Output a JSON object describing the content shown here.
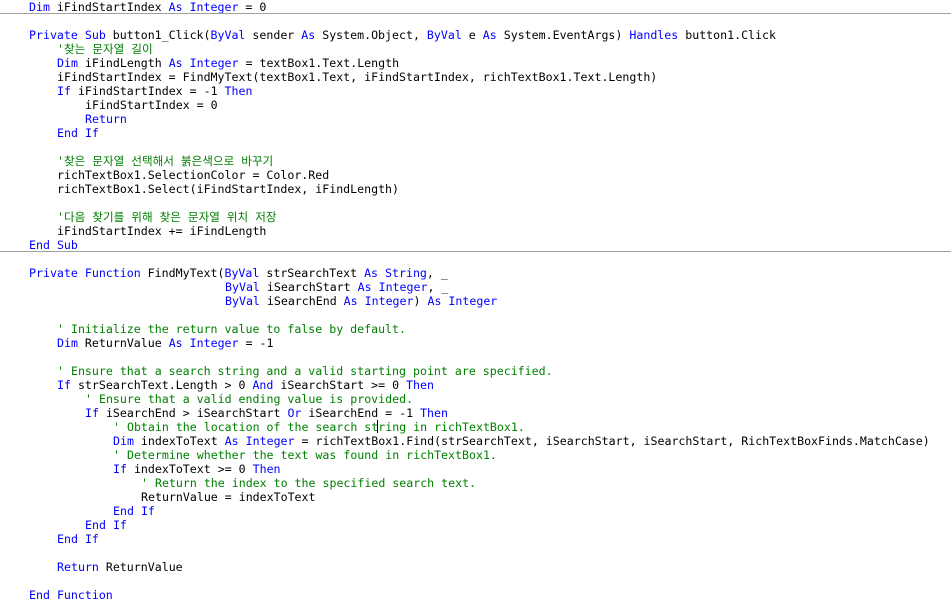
{
  "colors": {
    "keyword": "#0000ff",
    "comment": "#008000",
    "text": "#000000",
    "separator": "#a0a0a0",
    "background": "#ffffff"
  },
  "lines": [
    {
      "indent": 4,
      "tokens": [
        [
          "k",
          "Dim"
        ],
        [
          "t",
          " iFindStartIndex "
        ],
        [
          "k",
          "As"
        ],
        [
          "t",
          " "
        ],
        [
          "k",
          "Integer"
        ],
        [
          "t",
          " = 0"
        ]
      ]
    },
    {
      "indent": 0,
      "tokens": []
    },
    {
      "indent": 4,
      "tokens": [
        [
          "k",
          "Private"
        ],
        [
          "t",
          " "
        ],
        [
          "k",
          "Sub"
        ],
        [
          "t",
          " button1_Click("
        ],
        [
          "k",
          "ByVal"
        ],
        [
          "t",
          " sender "
        ],
        [
          "k",
          "As"
        ],
        [
          "t",
          " System.Object, "
        ],
        [
          "k",
          "ByVal"
        ],
        [
          "t",
          " e "
        ],
        [
          "k",
          "As"
        ],
        [
          "t",
          " System.EventArgs) "
        ],
        [
          "k",
          "Handles"
        ],
        [
          "t",
          " button1.Click"
        ]
      ]
    },
    {
      "indent": 8,
      "tokens": [
        [
          "c",
          "'찾는 문자열 길이"
        ]
      ]
    },
    {
      "indent": 8,
      "tokens": [
        [
          "k",
          "Dim"
        ],
        [
          "t",
          " iFindLength "
        ],
        [
          "k",
          "As"
        ],
        [
          "t",
          " "
        ],
        [
          "k",
          "Integer"
        ],
        [
          "t",
          " = textBox1.Text.Length"
        ]
      ]
    },
    {
      "indent": 8,
      "tokens": [
        [
          "t",
          "iFindStartIndex = FindMyText(textBox1.Text, iFindStartIndex, richTextBox1.Text.Length)"
        ]
      ]
    },
    {
      "indent": 8,
      "tokens": [
        [
          "k",
          "If"
        ],
        [
          "t",
          " iFindStartIndex = -1 "
        ],
        [
          "k",
          "Then"
        ]
      ]
    },
    {
      "indent": 12,
      "tokens": [
        [
          "t",
          "iFindStartIndex = 0"
        ]
      ]
    },
    {
      "indent": 12,
      "tokens": [
        [
          "k",
          "Return"
        ]
      ]
    },
    {
      "indent": 8,
      "tokens": [
        [
          "k",
          "End"
        ],
        [
          "t",
          " "
        ],
        [
          "k",
          "If"
        ]
      ]
    },
    {
      "indent": 0,
      "tokens": []
    },
    {
      "indent": 8,
      "tokens": [
        [
          "c",
          "'찾은 문자열 선택해서 붉은색으로 바꾸기"
        ]
      ]
    },
    {
      "indent": 8,
      "tokens": [
        [
          "t",
          "richTextBox1.SelectionColor = Color.Red"
        ]
      ]
    },
    {
      "indent": 8,
      "tokens": [
        [
          "t",
          "richTextBox1.Select(iFindStartIndex, iFindLength)"
        ]
      ]
    },
    {
      "indent": 0,
      "tokens": []
    },
    {
      "indent": 8,
      "tokens": [
        [
          "c",
          "'다음 찾기를 위해 찾은 문자열 위치 저장"
        ]
      ]
    },
    {
      "indent": 8,
      "tokens": [
        [
          "t",
          "iFindStartIndex += iFindLength"
        ]
      ]
    },
    {
      "indent": 4,
      "tokens": [
        [
          "k",
          "End"
        ],
        [
          "t",
          " "
        ],
        [
          "k",
          "Sub"
        ]
      ]
    },
    {
      "indent": 0,
      "tokens": []
    },
    {
      "indent": 4,
      "tokens": [
        [
          "k",
          "Private"
        ],
        [
          "t",
          " "
        ],
        [
          "k",
          "Function"
        ],
        [
          "t",
          " FindMyText("
        ],
        [
          "k",
          "ByVal"
        ],
        [
          "t",
          " strSearchText "
        ],
        [
          "k",
          "As"
        ],
        [
          "t",
          " "
        ],
        [
          "k",
          "String"
        ],
        [
          "t",
          ", _"
        ]
      ]
    },
    {
      "indent": 32,
      "tokens": [
        [
          "k",
          "ByVal"
        ],
        [
          "t",
          " iSearchStart "
        ],
        [
          "k",
          "As"
        ],
        [
          "t",
          " "
        ],
        [
          "k",
          "Integer"
        ],
        [
          "t",
          ", _"
        ]
      ]
    },
    {
      "indent": 32,
      "tokens": [
        [
          "k",
          "ByVal"
        ],
        [
          "t",
          " iSearchEnd "
        ],
        [
          "k",
          "As"
        ],
        [
          "t",
          " "
        ],
        [
          "k",
          "Integer"
        ],
        [
          "t",
          ") "
        ],
        [
          "k",
          "As"
        ],
        [
          "t",
          " "
        ],
        [
          "k",
          "Integer"
        ]
      ]
    },
    {
      "indent": 0,
      "tokens": []
    },
    {
      "indent": 8,
      "tokens": [
        [
          "c",
          "' Initialize the return value to false by default."
        ]
      ]
    },
    {
      "indent": 8,
      "tokens": [
        [
          "k",
          "Dim"
        ],
        [
          "t",
          " ReturnValue "
        ],
        [
          "k",
          "As"
        ],
        [
          "t",
          " "
        ],
        [
          "k",
          "Integer"
        ],
        [
          "t",
          " = -1"
        ]
      ]
    },
    {
      "indent": 0,
      "tokens": []
    },
    {
      "indent": 8,
      "tokens": [
        [
          "c",
          "' Ensure that a search string and a valid starting point are specified."
        ]
      ]
    },
    {
      "indent": 8,
      "tokens": [
        [
          "k",
          "If"
        ],
        [
          "t",
          " strSearchText.Length > 0 "
        ],
        [
          "k",
          "And"
        ],
        [
          "t",
          " iSearchStart >= 0 "
        ],
        [
          "k",
          "Then"
        ]
      ]
    },
    {
      "indent": 12,
      "tokens": [
        [
          "c",
          "' Ensure that a valid ending value is provided."
        ]
      ]
    },
    {
      "indent": 12,
      "tokens": [
        [
          "k",
          "If"
        ],
        [
          "t",
          " iSearchEnd > iSearchStart "
        ],
        [
          "k",
          "Or"
        ],
        [
          "t",
          " iSearchEnd = -1 "
        ],
        [
          "k",
          "Then"
        ]
      ]
    },
    {
      "indent": 16,
      "tokens": [
        [
          "c",
          "' Obtain the location of the search string in richTextBox1."
        ]
      ]
    },
    {
      "indent": 16,
      "tokens": [
        [
          "k",
          "Dim"
        ],
        [
          "t",
          " indexToText "
        ],
        [
          "k",
          "As"
        ],
        [
          "t",
          " "
        ],
        [
          "k",
          "Integer"
        ],
        [
          "t",
          " = richTextBox1.Find(strSearchText, iSearchStart, iSearchStart, RichTextBoxFinds.MatchCase)"
        ]
      ]
    },
    {
      "indent": 16,
      "tokens": [
        [
          "c",
          "' Determine whether the text was found in richTextBox1."
        ]
      ]
    },
    {
      "indent": 16,
      "tokens": [
        [
          "k",
          "If"
        ],
        [
          "t",
          " indexToText >= 0 "
        ],
        [
          "k",
          "Then"
        ]
      ]
    },
    {
      "indent": 20,
      "tokens": [
        [
          "c",
          "' Return the index to the specified search text."
        ]
      ]
    },
    {
      "indent": 20,
      "tokens": [
        [
          "t",
          "ReturnValue = indexToText"
        ]
      ]
    },
    {
      "indent": 16,
      "tokens": [
        [
          "k",
          "End"
        ],
        [
          "t",
          " "
        ],
        [
          "k",
          "If"
        ]
      ]
    },
    {
      "indent": 12,
      "tokens": [
        [
          "k",
          "End"
        ],
        [
          "t",
          " "
        ],
        [
          "k",
          "If"
        ]
      ]
    },
    {
      "indent": 8,
      "tokens": [
        [
          "k",
          "End"
        ],
        [
          "t",
          " "
        ],
        [
          "k",
          "If"
        ]
      ]
    },
    {
      "indent": 0,
      "tokens": []
    },
    {
      "indent": 8,
      "tokens": [
        [
          "k",
          "Return"
        ],
        [
          "t",
          " ReturnValue"
        ]
      ]
    },
    {
      "indent": 0,
      "tokens": []
    },
    {
      "indent": 4,
      "tokens": [
        [
          "k",
          "End"
        ],
        [
          "t",
          " "
        ],
        [
          "k",
          "Function"
        ]
      ]
    }
  ]
}
